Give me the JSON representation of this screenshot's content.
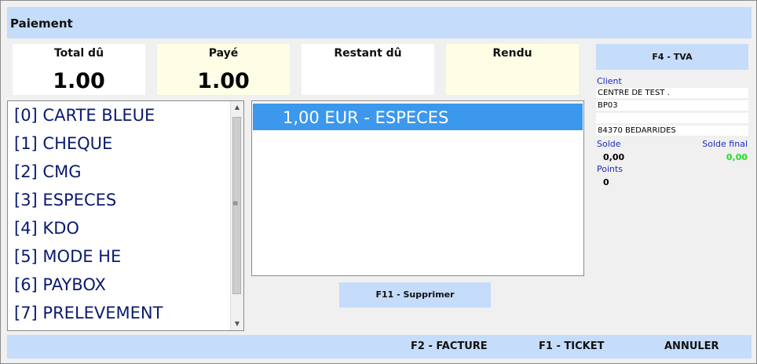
{
  "window": {
    "title": "Paiement"
  },
  "summary": {
    "total_label": "Total dû",
    "total_value": "1.00",
    "paid_label": "Payé",
    "paid_value": "1.00",
    "remaining_label": "Restant dû",
    "remaining_value": "",
    "change_label": "Rendu",
    "change_value": ""
  },
  "buttons": {
    "tva": "F4 - TVA",
    "delete": "F11 - Supprimer",
    "invoice": "F2 - FACTURE",
    "ticket": "F1 - TICKET",
    "cancel": "ANNULER"
  },
  "payment_methods": [
    "[0] CARTE BLEUE",
    "[1] CHEQUE",
    "[2] CMG",
    "[3] ESPECES",
    "[4] KDO",
    "[5] MODE HE",
    "[6] PAYBOX",
    "[7] PRELEVEMENT"
  ],
  "payments": [
    "1,00 EUR - ESPECES"
  ],
  "client": {
    "label": "Client",
    "lines": [
      "CENTRE DE TEST .",
      "BP03",
      "",
      "84370 BEDARRIDES"
    ],
    "balance_label": "Solde",
    "balance_value": "0,00",
    "final_balance_label": "Solde final",
    "final_balance_value": "0,00",
    "points_label": "Points",
    "points_value": "0"
  },
  "colors": {
    "accent_bar": "#c5dcfa",
    "selected_row": "#3b98ec",
    "method_text": "#0a1a6e",
    "client_label": "#1a2bbf",
    "final_balance": "#22dd22"
  },
  "icons": {
    "scroll_up": "▲",
    "scroll_down": "▼",
    "scroll_grip": "≡"
  }
}
